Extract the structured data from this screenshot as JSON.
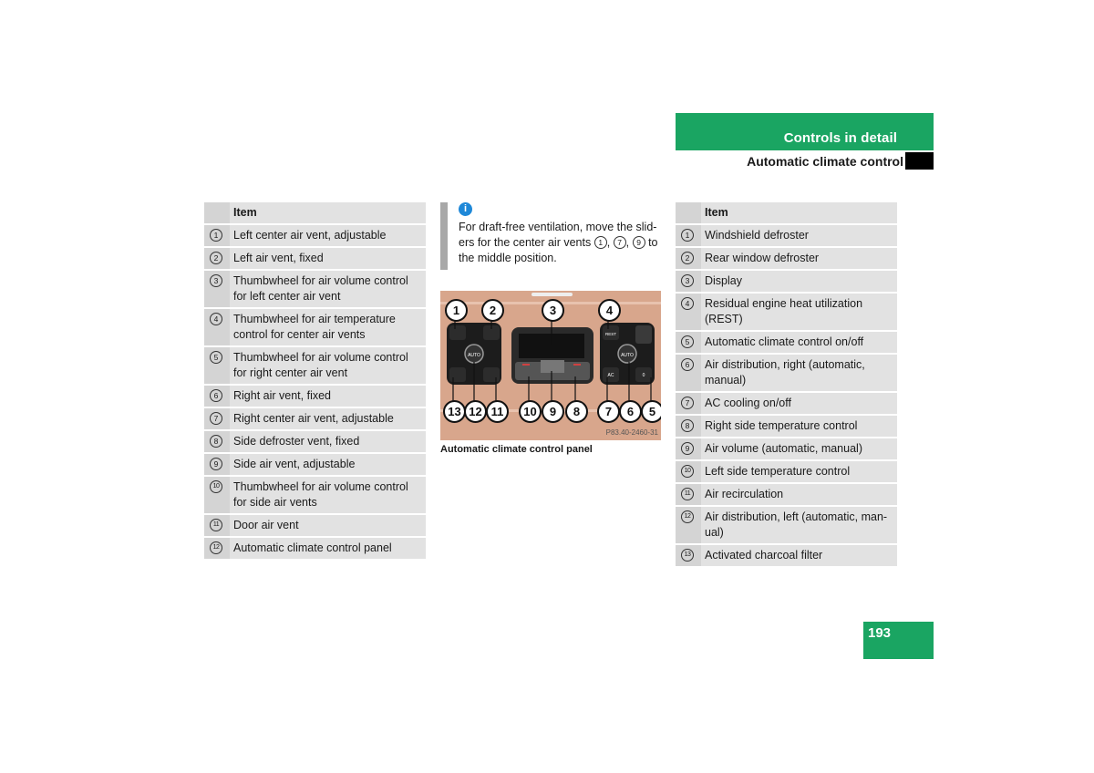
{
  "header": {
    "section": "Controls in detail",
    "subsection": "Automatic climate control"
  },
  "left_table": {
    "header": "Item",
    "rows": [
      {
        "num": "1",
        "text": "Left center air vent, adjustable"
      },
      {
        "num": "2",
        "text": "Left air vent, fixed"
      },
      {
        "num": "3",
        "text": "Thumbwheel for air volume control for left center air vent"
      },
      {
        "num": "4",
        "text": "Thumbwheel for air temperature control for center air vents"
      },
      {
        "num": "5",
        "text": "Thumbwheel for air volume control for right center air vent"
      },
      {
        "num": "6",
        "text": "Right air vent, fixed"
      },
      {
        "num": "7",
        "text": "Right center air vent, adjustable"
      },
      {
        "num": "8",
        "text": "Side defroster vent, fixed"
      },
      {
        "num": "9",
        "text": "Side air vent, adjustable"
      },
      {
        "num": "10",
        "text": "Thumbwheel for air volume control for side air vents"
      },
      {
        "num": "11",
        "text": "Door air vent"
      },
      {
        "num": "12",
        "text": "Automatic climate control panel"
      }
    ]
  },
  "note": {
    "icon": "info-icon",
    "text_before": "For draft-free ventilation, move the slid-ers for the center air vents ",
    "refs": [
      "1",
      "7",
      "9"
    ],
    "text_after": " to the middle position."
  },
  "figure": {
    "caption": "Automatic climate control panel",
    "image_code": "P83.40-2460-31",
    "callouts_top": [
      "1",
      "2",
      "3",
      "4"
    ],
    "callouts_bottom": [
      "13",
      "12",
      "11",
      "10",
      "9",
      "8",
      "7",
      "6",
      "5"
    ],
    "button_labels": {
      "auto": "AUTO",
      "rest": "REST",
      "ac": "AC",
      "off": "0"
    }
  },
  "right_table": {
    "header": "Item",
    "rows": [
      {
        "num": "1",
        "text": "Windshield defroster"
      },
      {
        "num": "2",
        "text": "Rear window defroster"
      },
      {
        "num": "3",
        "text": "Display"
      },
      {
        "num": "4",
        "text": "Residual engine heat utilization (REST)"
      },
      {
        "num": "5",
        "text": "Automatic climate control on/off"
      },
      {
        "num": "6",
        "text": "Air distribution, right (automatic, manual)"
      },
      {
        "num": "7",
        "text": "AC cooling on/off"
      },
      {
        "num": "8",
        "text": "Right side temperature control"
      },
      {
        "num": "9",
        "text": "Air volume (automatic, manual)"
      },
      {
        "num": "10",
        "text": "Left side temperature control"
      },
      {
        "num": "11",
        "text": "Air recirculation"
      },
      {
        "num": "12",
        "text": "Air distribution, left (automatic, man-ual)"
      },
      {
        "num": "13",
        "text": "Activated charcoal filter"
      }
    ]
  },
  "page_number": "193",
  "colors": {
    "accent_green": "#1aa562",
    "info_blue": "#1e88d8"
  }
}
